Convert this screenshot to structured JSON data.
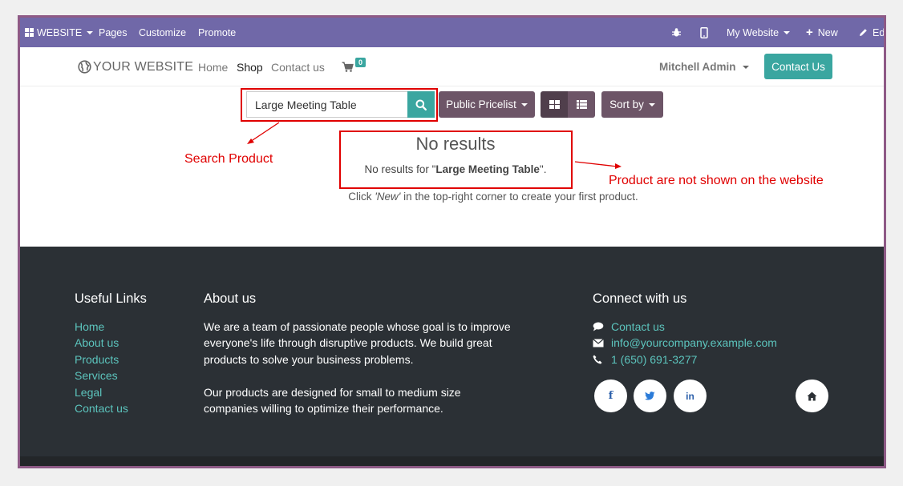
{
  "topbar": {
    "website_label": "WEBSITE",
    "pages": "Pages",
    "customize": "Customize",
    "promote": "Promote",
    "my_website": "My Website",
    "new": "New",
    "edit": "Ed"
  },
  "navbar": {
    "logo": "YOUR WEBSITE",
    "home": "Home",
    "shop": "Shop",
    "contact": "Contact us",
    "cart_count": "0",
    "user": "Mitchell Admin",
    "contact_button": "Contact Us"
  },
  "search": {
    "value": "Large Meeting Table",
    "pricelist": "Public Pricelist",
    "sort": "Sort by"
  },
  "results": {
    "title": "No results",
    "prefix": "No results for \"",
    "query": "Large Meeting Table",
    "suffix": "\".",
    "hint_prefix": "Click ",
    "hint_new": "'New'",
    "hint_suffix": " in the top-right corner to create your first product."
  },
  "annotations": {
    "search_product": "Search Product",
    "not_shown": "Product are not shown on the website"
  },
  "footer": {
    "useful_links_title": "Useful Links",
    "links": [
      "Home",
      "About us",
      "Products",
      "Services",
      "Legal",
      "Contact us"
    ],
    "about_title": "About us",
    "about_p1_l1": "We are a team of passionate people whose goal is to improve",
    "about_p1_l2": "everyone's life through disruptive products. We build great",
    "about_p1_l3": "products to solve your business problems.",
    "about_p2_l1": "Our products are designed for small to medium size",
    "about_p2_l2": "companies willing to optimize their performance.",
    "connect_title": "Connect with us",
    "contact_link": "Contact us",
    "email": "info@yourcompany.example.com",
    "phone": "1 (650) 691-3277"
  },
  "colors": {
    "topbar": "#7068a8",
    "accent": "#3aa6a0",
    "footer": "#2b3035",
    "annotation": "#e00000"
  }
}
